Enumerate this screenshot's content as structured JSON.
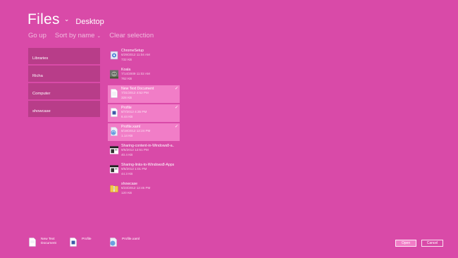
{
  "header": {
    "title": "Files",
    "location": "Desktop"
  },
  "toolbar": {
    "go_up": "Go up",
    "sort": "Sort by name",
    "clear": "Clear selection"
  },
  "nav": {
    "items": [
      {
        "label": "Libraries"
      },
      {
        "label": "Richa"
      },
      {
        "label": "Computer"
      },
      {
        "label": "showcase"
      }
    ]
  },
  "files": [
    {
      "name": "ChromeSetup",
      "date": "6/29/2012 11:04 AM",
      "size": "732 KB",
      "icon": "setup-icon",
      "selected": false
    },
    {
      "name": "Koala",
      "date": "7/14/2009 11:02 AM",
      "size": "762 KB",
      "icon": "image-thumbnail-icon",
      "selected": false
    },
    {
      "name": "New Text Document",
      "date": "7/31/2012 4:52 PM",
      "size": "328 KB",
      "icon": "text-document-icon",
      "selected": true
    },
    {
      "name": "Profile",
      "date": "8/7/2012 4:35 PM",
      "size": "6.44 KB",
      "icon": "document-icon",
      "selected": true
    },
    {
      "name": "Profile.xaml",
      "date": "8/19/2012 12:24 PM",
      "size": "1.14 KB",
      "icon": "xaml-file-icon",
      "selected": true
    },
    {
      "name": "Sharing-content-in-Windows8-a...",
      "date": "9/5/2012 12:51 PM",
      "size": "40.4 KB",
      "icon": "screenshot-icon",
      "selected": false
    },
    {
      "name": "Sharing-links-to-Windows8-Apps",
      "date": "9/5/2012 1:01 PM",
      "size": "44.3 KB",
      "icon": "screenshot-icon",
      "selected": false
    },
    {
      "name": "showcase",
      "date": "6/23/2012 12:45 PM",
      "size": "120 KB",
      "icon": "zip-folder-icon",
      "selected": false
    }
  ],
  "basket": {
    "items": [
      {
        "label": "New Text Document",
        "icon": "text-document-icon"
      },
      {
        "label": "Profile",
        "icon": "document-icon"
      },
      {
        "label": "Profile.xaml",
        "icon": "xaml-file-icon"
      }
    ]
  },
  "buttons": {
    "open": "Open",
    "cancel": "Cancel"
  },
  "colors": {
    "background": "#d94aa8",
    "nav_tile": "#b83d89",
    "selected": "#f17dc7"
  }
}
